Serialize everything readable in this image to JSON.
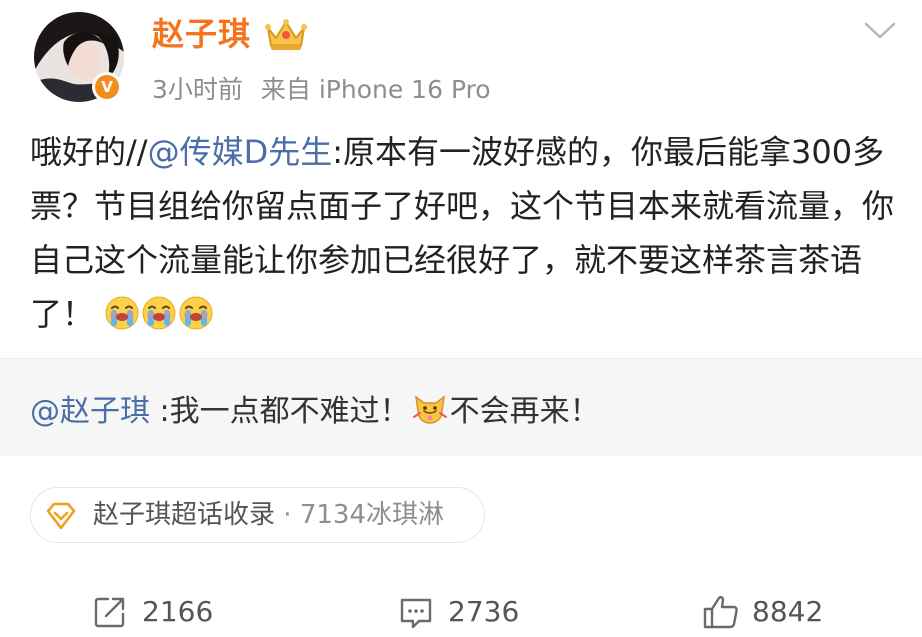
{
  "header": {
    "username": "赵子琪",
    "time": "3小时前",
    "source": "来自 iPhone 16 Pro",
    "badge_letter": "V",
    "icons": {
      "crown": "crown-badge-icon",
      "verified": "verified-v-icon",
      "more": "chevron-down-icon"
    }
  },
  "post": {
    "prefix": "哦好的//",
    "mention": "@传媒D先生",
    "body": ":原本有一波好感的，你最后能拿300多票？节目组给你留点面子了好吧，这个节目本来就看流量，你自己这个流量能让你参加已经很好了，就不要这样茶言茶语了！",
    "emoji_icon": "crying-face-emoji",
    "emoji_count": 3
  },
  "repost": {
    "mention": "@赵子琪",
    "text_before": " :我一点都不难过！",
    "text_after": "不会再来！",
    "sticker_icon": "fox-sticker-icon"
  },
  "topic_chip": {
    "label": "赵子琪超话收录",
    "separator": " · ",
    "count": "7134冰琪淋",
    "icon": "diamond-icon"
  },
  "actions": {
    "repost_count": "2166",
    "comment_count": "2736",
    "like_count": "8842"
  },
  "colors": {
    "username": "#f5731a",
    "mention": "#4a6ea8",
    "meta": "#8e8e8e",
    "repost_bg": "#f6f6f6",
    "badge": "#f28c1e"
  }
}
